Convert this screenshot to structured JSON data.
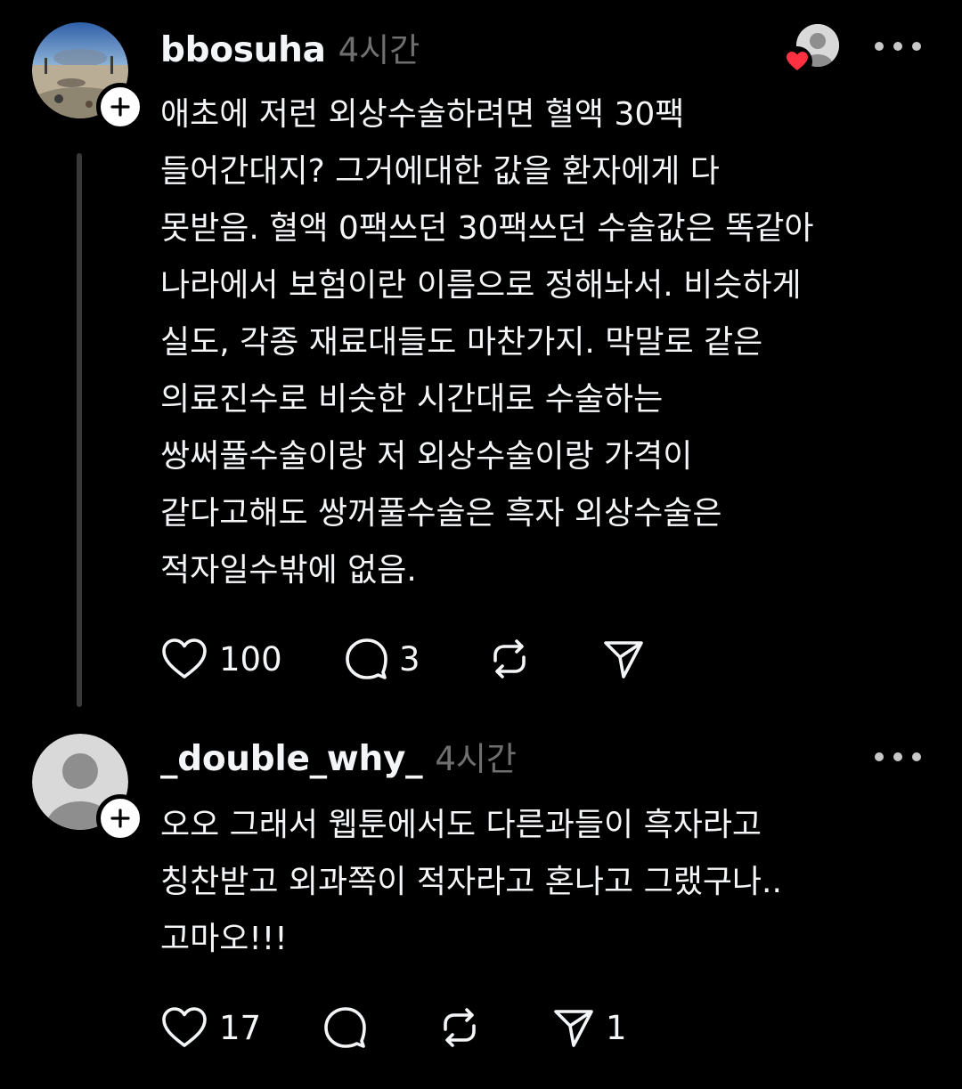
{
  "posts": [
    {
      "username": "bbosuha",
      "time": "4시간",
      "body": "애초에 저런 외상수술하려면 혈액 30팩\n들어간대지? 그거에대한 값을 환자에게 다\n못받음. 혈액 0팩쓰던 30팩쓰던 수술값은 똑같아\n나라에서 보험이란 이름으로 정해놔서. 비슷하게\n실도, 각종 재료대들도 마찬가지. 막말로 같은\n의료진수로 비슷한 시간대로 수술하는\n쌍써풀수술이랑 저 외상수술이랑 가격이\n같다고해도 쌍꺼풀수술은 흑자 외상수술은\n적자일수밖에 없음.",
      "likes": "100",
      "replies": "3",
      "reposts": "",
      "shares": ""
    },
    {
      "username": "_double_why_",
      "time": "4시간",
      "body": "오오 그래서 웹툰에서도 다른과들이 흑자라고\n칭찬받고 외과쪽이 적자라고 혼나고 그랬구나..\n고마오!!!",
      "likes": "17",
      "replies": "",
      "reposts": "",
      "shares": "1"
    }
  ],
  "icons": {
    "like": "heart-icon",
    "reply": "comment-bubble-icon",
    "repost": "repost-icon",
    "share": "send-icon",
    "more": "more-dots-icon",
    "follow": "plus-icon"
  },
  "colors": {
    "background": "#000000",
    "text": "#f3f5f7",
    "muted": "#6f6f6f",
    "heart": "#ff3040"
  }
}
